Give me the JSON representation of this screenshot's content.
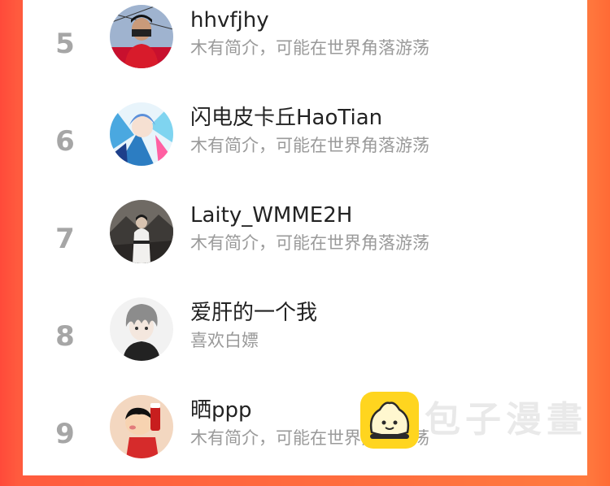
{
  "ranking": {
    "items": [
      {
        "rank": "5",
        "name": "hhvfjhy",
        "desc": "木有简介，可能在世界角落游荡"
      },
      {
        "rank": "6",
        "name": "闪电皮卡丘HaoTian",
        "desc": "木有简介，可能在世界角落游荡"
      },
      {
        "rank": "7",
        "name": "Laity_WMME2H",
        "desc": "木有简介，可能在世界角落游荡"
      },
      {
        "rank": "8",
        "name": "爱肝的一个我",
        "desc": "喜欢白嫖"
      },
      {
        "rank": "9",
        "name": "晒ppp",
        "desc": "木有简介，可能在世界角落游荡"
      }
    ]
  },
  "watermark": {
    "text": "包子漫畫"
  },
  "colors": {
    "background_left": "#ff4a3a",
    "background_right": "#ff7a3f",
    "rank_number": "#a6a6a6",
    "name_text": "#222222",
    "desc_text": "#9a9a9a",
    "logo_yellow": "#ffd51f"
  }
}
